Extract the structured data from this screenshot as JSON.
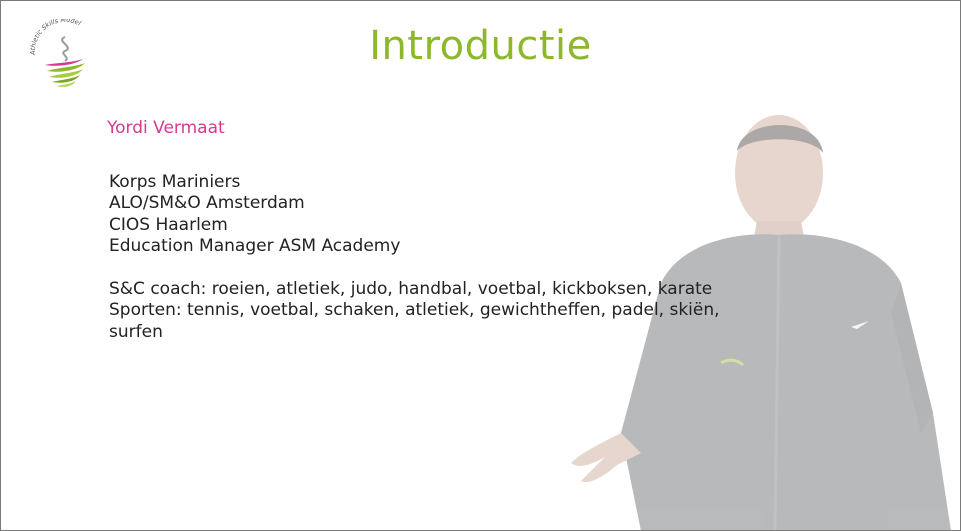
{
  "logo": {
    "text": "Athletic Skills Model",
    "colors": {
      "green": "#8cb82a",
      "pink": "#d63a8d",
      "gray": "#9a9a9a"
    }
  },
  "title": "Introductie",
  "name": "Yordi Vermaat",
  "background": [
    "Korps Mariniers",
    "ALO/SM&O Amsterdam",
    "CIOS Haarlem",
    "Education Manager ASM Academy"
  ],
  "sports": [
    "S&C coach: roeien, atletiek, judo, handbal, voetbal, kickboksen, karate",
    "Sporten: tennis, voetbal, schaken, atletiek, gewichtheffen, padel, skiën,",
    "surfen"
  ],
  "colors": {
    "title": "#8cb82a",
    "name": "#d63a8d",
    "text": "#222222"
  }
}
